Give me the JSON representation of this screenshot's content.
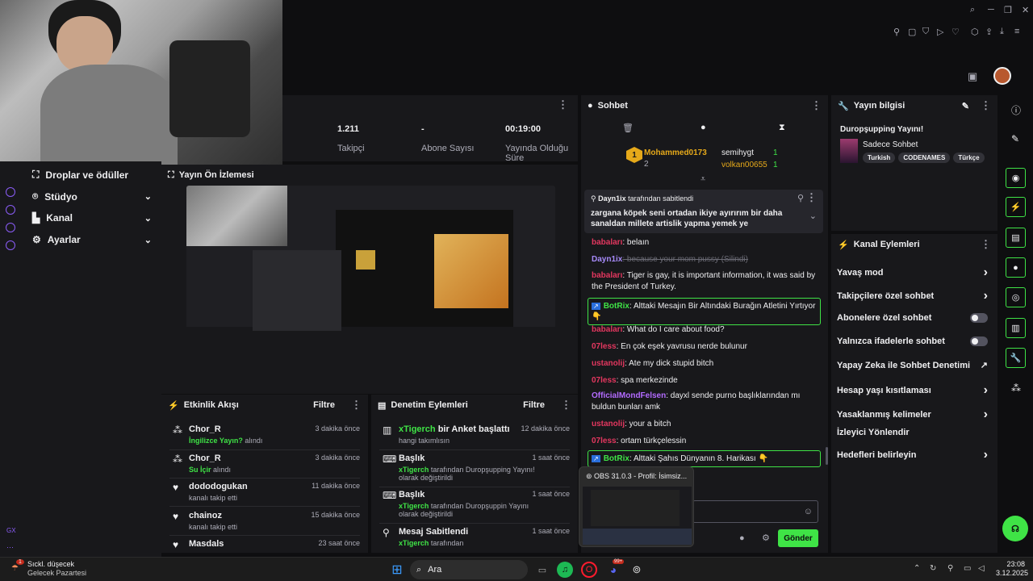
{
  "colors": {
    "accent_green": "#3fe346",
    "purple": "#8a5cf6",
    "bg": "#0e0e10",
    "panel": "#18181b"
  },
  "stats": [
    {
      "value": "1.211",
      "label": "Takipçi"
    },
    {
      "value": "-",
      "label": "Abone Sayısı"
    },
    {
      "value": "00:19:00",
      "label": "Yayında Olduğu Süre"
    }
  ],
  "nav": {
    "items": [
      {
        "label": "Droplar ve ödüller",
        "icon": "gift-icon"
      },
      {
        "label": "Stüdyo",
        "icon": "studio-icon"
      },
      {
        "label": "Kanal",
        "icon": "channel-icon"
      },
      {
        "label": "Ayarlar",
        "icon": "gear-icon"
      }
    ],
    "footer": "GX"
  },
  "preview": {
    "title": "Yayın Ön İzlemesi"
  },
  "activity": {
    "title": "Etkinlik Akışı",
    "filter": "Filtre",
    "items": [
      {
        "name": "Chor_R",
        "time": "3 dakika önce",
        "highlight": "İngilizce Yayın?",
        "rest": " alındı"
      },
      {
        "name": "Chor_R",
        "time": "3 dakika önce",
        "highlight": "Su İçir",
        "rest": " alındı"
      },
      {
        "name": "dododogukan",
        "time": "11 dakika önce",
        "highlight": "",
        "rest": "kanalı takip etti"
      },
      {
        "name": "chainoz",
        "time": "15 dakika önce",
        "highlight": "",
        "rest": "kanalı takip etti"
      },
      {
        "name": "Masdals",
        "time": "23 saat önce",
        "highlight": "",
        "rest": ""
      }
    ]
  },
  "audit": {
    "title": "Denetim Eylemleri",
    "filter": "Filtre",
    "items": [
      {
        "title_user": "xTigerch",
        "title_rest": " bir Anket başlattı",
        "time": "12 dakika önce",
        "sub_user": "",
        "sub": "hangi takımlısın"
      },
      {
        "title_user": "",
        "title_rest": "Başlık",
        "time": "1 saat önce",
        "sub_user": "xTigerch",
        "sub": " tarafından Duropşupping Yayını! olarak değiştirildi"
      },
      {
        "title_user": "",
        "title_rest": "Başlık",
        "time": "1 saat önce",
        "sub_user": "xTigerch",
        "sub": " tarafından Duropşuppin Yayını olarak değiştirildi"
      },
      {
        "title_user": "",
        "title_rest": "Mesaj Sabitlendi",
        "time": "1 saat önce",
        "sub_user": "xTigerch",
        "sub": " tarafından"
      }
    ]
  },
  "chat": {
    "title": "Sohbet",
    "leaders": [
      {
        "rank": "1",
        "name": "Mohammed0173",
        "count": "2"
      },
      {
        "rank": "",
        "name": "semihygt",
        "count": "1"
      },
      {
        "rank": "",
        "name": "volkan00655",
        "count": "1"
      }
    ],
    "pinned_by": "Dayn1ix",
    "pinned_suffix": " tarafından sabitlendi",
    "pinned_text": "zargana köpek seni ortadan ikiye ayırırım bir daha sanaldan millete artislik yapma yemek ye",
    "messages": [
      {
        "user": "babaları",
        "color": "#e3375f",
        "text": ": belaın",
        "bot": false,
        "strike": false
      },
      {
        "user": "Dayn1ix",
        "color": "#a78bfa",
        "text": ": because your mom pussy (Silindi)",
        "bot": false,
        "strike": true
      },
      {
        "user": "babaları",
        "color": "#e3375f",
        "text": ": Tiger is gay, it is important information, it was said by the President of Turkey.",
        "bot": false,
        "strike": false
      },
      {
        "user": "BotRix",
        "color": "#3fe346",
        "text": ": Alttaki Mesajın Bir Altındaki Burağın Atletini Yırtıyor 👇",
        "bot": true,
        "strike": false
      },
      {
        "user": "babaları",
        "color": "#e3375f",
        "text": ": What do I care about food?",
        "bot": false,
        "strike": false
      },
      {
        "user": "07less",
        "color": "#e3375f",
        "text": ": En çok eşek yavrusu nerde bulunur",
        "bot": false,
        "strike": false
      },
      {
        "user": "ustanolij",
        "color": "#e3375f",
        "text": ": Ate my dick stupid bitch",
        "bot": false,
        "strike": false
      },
      {
        "user": "07less",
        "color": "#e3375f",
        "text": ": spa merkezinde",
        "bot": false,
        "strike": false
      },
      {
        "user": "OfficialMondFelsen",
        "color": "#b36bff",
        "text": ": dayxl sende purno başlıklarından mı buldun bunları amk",
        "bot": false,
        "strike": false
      },
      {
        "user": "ustanolij",
        "color": "#e3375f",
        "text": ": your a bitch",
        "bot": false,
        "strike": false
      },
      {
        "user": "07less",
        "color": "#e3375f",
        "text": ": ortam türkçelessin",
        "bot": false,
        "strike": false
      },
      {
        "user": "BotRix",
        "color": "#3fe346",
        "text": ": Alttaki Şahıs Dünyanın 8. Harikası 👇",
        "bot": true,
        "strike": false
      }
    ],
    "send": "Gönder"
  },
  "info": {
    "title": "Yayın bilgisi",
    "stream_title": "Duropşupping Yayını!",
    "category": "Sadece Sohbet",
    "tags": [
      "Turkish",
      "CODENAMES",
      "Türkçe"
    ]
  },
  "actions": {
    "title": "Kanal Eylemleri",
    "items": [
      {
        "label": "Yavaş mod",
        "control": "chevron"
      },
      {
        "label": "Takipçilere özel sohbet",
        "control": "chevron"
      },
      {
        "label": "Abonelere özel sohbet",
        "control": "toggle"
      },
      {
        "label": "Yalnızca ifadelerle sohbet",
        "control": "toggle"
      },
      {
        "label": "Yapay Zeka ile Sohbet Denetimi",
        "control": "external"
      },
      {
        "label": "Hesap yaşı kısıtlaması",
        "control": "chevron"
      },
      {
        "label": "Yasaklanmış kelimeler",
        "control": "chevron"
      },
      {
        "label": "İzleyici Yönlendir",
        "control": "none"
      },
      {
        "label": "Hedefleri belirleyin",
        "control": "chevron"
      }
    ]
  },
  "obs": {
    "title": "OBS 31.0.3 - Profil: İsimsiz..."
  },
  "taskbar": {
    "weather_title": "Sıckl. düşecek",
    "weather_sub": "Gelecek Pazartesi",
    "search": "Ara",
    "time": "23:08",
    "date": "3.12.2025",
    "badge": "1",
    "discord_badge": "99+"
  }
}
